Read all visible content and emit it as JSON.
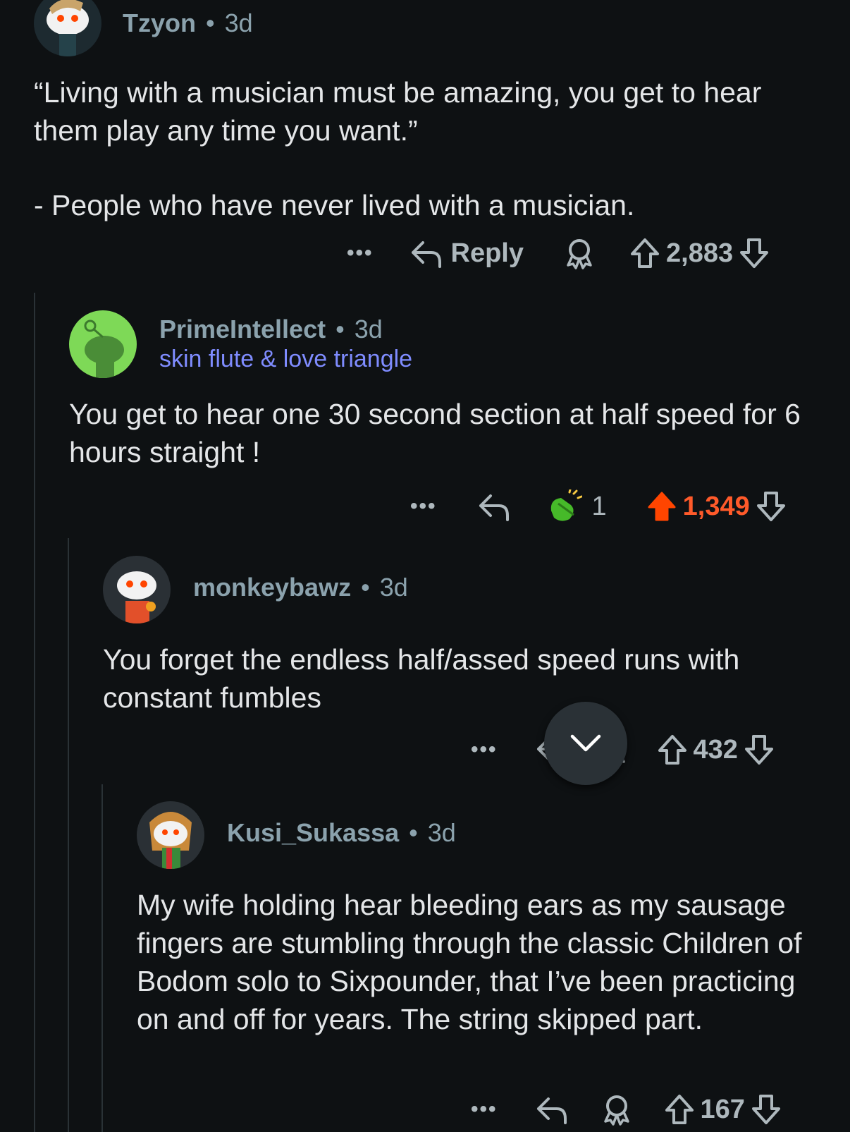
{
  "comments": [
    {
      "author": "Tzyon",
      "separator": "•",
      "age": "3d",
      "body": [
        "“Living with a musician must be amazing, you get to hear them play any time you want.”",
        "- People who have never lived with a musician."
      ],
      "actions": {
        "more": "•••",
        "reply": "Reply",
        "score": "2,883"
      }
    },
    {
      "author": "PrimeIntellect",
      "separator": "•",
      "age": "3d",
      "flair": "skin flute & love triangle",
      "body": [
        "You get to hear one 30 second section at half speed for 6 hours straight !"
      ],
      "actions": {
        "more": "•••",
        "award_count": "1",
        "score": "1,349",
        "upvoted": true
      }
    },
    {
      "author": "monkeybawz",
      "separator": "•",
      "age": "3d",
      "body": [
        "You forget the endless half/assed speed runs with constant fumbles"
      ],
      "actions": {
        "more": "•••",
        "score": "432"
      }
    },
    {
      "author": "Kusi_Sukassa",
      "separator": "•",
      "age": "3d",
      "body": [
        "My wife holding hear bleeding ears as my sausage fingers are stumbling through the classic Children of Bodom solo to Sixpounder, that I’ve been practicing on and off for years. The string skipped part."
      ],
      "actions": {
        "more": "•••",
        "score": "167"
      }
    }
  ],
  "colors": {
    "background": "#0e1113",
    "upvote_active": "#ff5a2a",
    "flair": "#7f8cff",
    "thread_line": "#2a3236"
  }
}
